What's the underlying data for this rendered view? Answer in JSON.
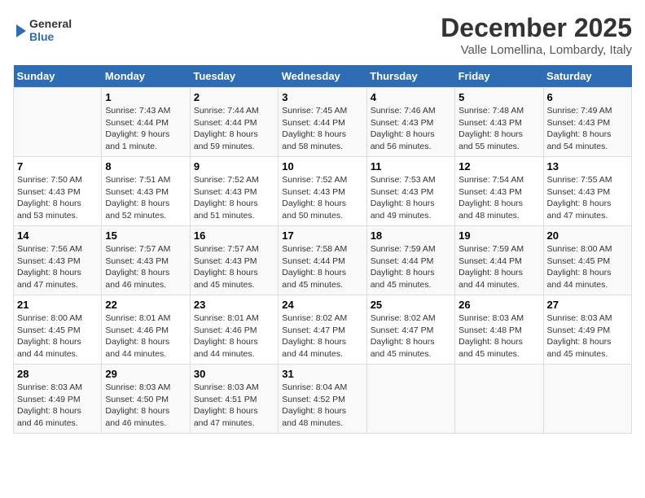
{
  "logo": {
    "text_general": "General",
    "text_blue": "Blue"
  },
  "calendar": {
    "title": "December 2025",
    "subtitle": "Valle Lomellina, Lombardy, Italy"
  },
  "weekdays": [
    "Sunday",
    "Monday",
    "Tuesday",
    "Wednesday",
    "Thursday",
    "Friday",
    "Saturday"
  ],
  "weeks": [
    [
      {
        "day": "",
        "info": ""
      },
      {
        "day": "1",
        "info": "Sunrise: 7:43 AM\nSunset: 4:44 PM\nDaylight: 9 hours\nand 1 minute."
      },
      {
        "day": "2",
        "info": "Sunrise: 7:44 AM\nSunset: 4:44 PM\nDaylight: 8 hours\nand 59 minutes."
      },
      {
        "day": "3",
        "info": "Sunrise: 7:45 AM\nSunset: 4:44 PM\nDaylight: 8 hours\nand 58 minutes."
      },
      {
        "day": "4",
        "info": "Sunrise: 7:46 AM\nSunset: 4:43 PM\nDaylight: 8 hours\nand 56 minutes."
      },
      {
        "day": "5",
        "info": "Sunrise: 7:48 AM\nSunset: 4:43 PM\nDaylight: 8 hours\nand 55 minutes."
      },
      {
        "day": "6",
        "info": "Sunrise: 7:49 AM\nSunset: 4:43 PM\nDaylight: 8 hours\nand 54 minutes."
      }
    ],
    [
      {
        "day": "7",
        "info": "Sunrise: 7:50 AM\nSunset: 4:43 PM\nDaylight: 8 hours\nand 53 minutes."
      },
      {
        "day": "8",
        "info": "Sunrise: 7:51 AM\nSunset: 4:43 PM\nDaylight: 8 hours\nand 52 minutes."
      },
      {
        "day": "9",
        "info": "Sunrise: 7:52 AM\nSunset: 4:43 PM\nDaylight: 8 hours\nand 51 minutes."
      },
      {
        "day": "10",
        "info": "Sunrise: 7:52 AM\nSunset: 4:43 PM\nDaylight: 8 hours\nand 50 minutes."
      },
      {
        "day": "11",
        "info": "Sunrise: 7:53 AM\nSunset: 4:43 PM\nDaylight: 8 hours\nand 49 minutes."
      },
      {
        "day": "12",
        "info": "Sunrise: 7:54 AM\nSunset: 4:43 PM\nDaylight: 8 hours\nand 48 minutes."
      },
      {
        "day": "13",
        "info": "Sunrise: 7:55 AM\nSunset: 4:43 PM\nDaylight: 8 hours\nand 47 minutes."
      }
    ],
    [
      {
        "day": "14",
        "info": "Sunrise: 7:56 AM\nSunset: 4:43 PM\nDaylight: 8 hours\nand 47 minutes."
      },
      {
        "day": "15",
        "info": "Sunrise: 7:57 AM\nSunset: 4:43 PM\nDaylight: 8 hours\nand 46 minutes."
      },
      {
        "day": "16",
        "info": "Sunrise: 7:57 AM\nSunset: 4:43 PM\nDaylight: 8 hours\nand 45 minutes."
      },
      {
        "day": "17",
        "info": "Sunrise: 7:58 AM\nSunset: 4:44 PM\nDaylight: 8 hours\nand 45 minutes."
      },
      {
        "day": "18",
        "info": "Sunrise: 7:59 AM\nSunset: 4:44 PM\nDaylight: 8 hours\nand 45 minutes."
      },
      {
        "day": "19",
        "info": "Sunrise: 7:59 AM\nSunset: 4:44 PM\nDaylight: 8 hours\nand 44 minutes."
      },
      {
        "day": "20",
        "info": "Sunrise: 8:00 AM\nSunset: 4:45 PM\nDaylight: 8 hours\nand 44 minutes."
      }
    ],
    [
      {
        "day": "21",
        "info": "Sunrise: 8:00 AM\nSunset: 4:45 PM\nDaylight: 8 hours\nand 44 minutes."
      },
      {
        "day": "22",
        "info": "Sunrise: 8:01 AM\nSunset: 4:46 PM\nDaylight: 8 hours\nand 44 minutes."
      },
      {
        "day": "23",
        "info": "Sunrise: 8:01 AM\nSunset: 4:46 PM\nDaylight: 8 hours\nand 44 minutes."
      },
      {
        "day": "24",
        "info": "Sunrise: 8:02 AM\nSunset: 4:47 PM\nDaylight: 8 hours\nand 44 minutes."
      },
      {
        "day": "25",
        "info": "Sunrise: 8:02 AM\nSunset: 4:47 PM\nDaylight: 8 hours\nand 45 minutes."
      },
      {
        "day": "26",
        "info": "Sunrise: 8:03 AM\nSunset: 4:48 PM\nDaylight: 8 hours\nand 45 minutes."
      },
      {
        "day": "27",
        "info": "Sunrise: 8:03 AM\nSunset: 4:49 PM\nDaylight: 8 hours\nand 45 minutes."
      }
    ],
    [
      {
        "day": "28",
        "info": "Sunrise: 8:03 AM\nSunset: 4:49 PM\nDaylight: 8 hours\nand 46 minutes."
      },
      {
        "day": "29",
        "info": "Sunrise: 8:03 AM\nSunset: 4:50 PM\nDaylight: 8 hours\nand 46 minutes."
      },
      {
        "day": "30",
        "info": "Sunrise: 8:03 AM\nSunset: 4:51 PM\nDaylight: 8 hours\nand 47 minutes."
      },
      {
        "day": "31",
        "info": "Sunrise: 8:04 AM\nSunset: 4:52 PM\nDaylight: 8 hours\nand 48 minutes."
      },
      {
        "day": "",
        "info": ""
      },
      {
        "day": "",
        "info": ""
      },
      {
        "day": "",
        "info": ""
      }
    ]
  ]
}
